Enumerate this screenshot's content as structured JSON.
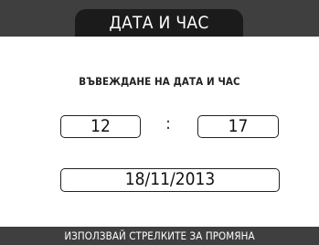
{
  "header": {
    "title": "ДАТА И ЧАС"
  },
  "prompt": {
    "text": "ВЪВЕЖДАНЕ НА ДАТА И ЧАС"
  },
  "time": {
    "hour": "12",
    "separator": ":",
    "minute": "17"
  },
  "date": {
    "value": "18/11/2013"
  },
  "footer": {
    "hint": "ИЗПОЛЗВАЙ СТРЕЛКИТЕ ЗА ПРОМЯНА"
  },
  "colors": {
    "bar_background": "#3f3f3f",
    "title_tab": "#1b1b1b",
    "screen_background": "#ffffff",
    "text": "#1a1a1a"
  }
}
